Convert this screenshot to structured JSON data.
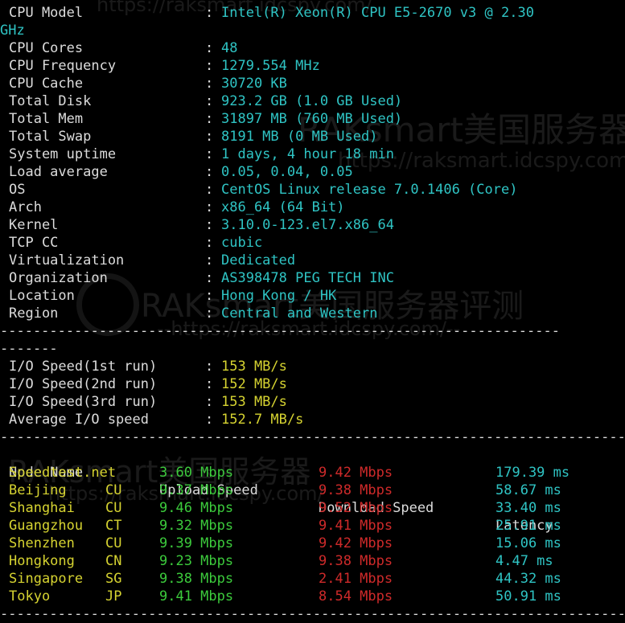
{
  "sysinfo": [
    {
      "label": "CPU Model",
      "value": "Intel(R) Xeon(R) CPU E5-2670 v3 @ 2.30"
    },
    {
      "label": "CPU Cores",
      "value": "48"
    },
    {
      "label": "CPU Frequency",
      "value": "1279.554 MHz"
    },
    {
      "label": "CPU Cache",
      "value": "30720 KB"
    },
    {
      "label": "Total Disk",
      "value": "923.2 GB (1.0 GB Used)"
    },
    {
      "label": "Total Mem",
      "value": "31897 MB (760 MB Used)"
    },
    {
      "label": "Total Swap",
      "value": "8191 MB (0 MB Used)"
    },
    {
      "label": "System uptime",
      "value": "1 days, 4 hour 18 min"
    },
    {
      "label": "Load average",
      "value": "0.05, 0.04, 0.05"
    },
    {
      "label": "OS",
      "value": "CentOS Linux release 7.0.1406 (Core)"
    },
    {
      "label": "Arch",
      "value": "x86_64 (64 Bit)"
    },
    {
      "label": "Kernel",
      "value": "3.10.0-123.el7.x86_64"
    },
    {
      "label": "TCP CC",
      "value": "cubic"
    },
    {
      "label": "Virtualization",
      "value": "Dedicated"
    },
    {
      "label": "Organization",
      "value": "AS398478 PEG TECH INC"
    },
    {
      "label": "Location",
      "value": "Hong Kong / HK"
    },
    {
      "label": "Region",
      "value": "Central and Western"
    }
  ],
  "cpu_wrap": "GHz",
  "separator": ":",
  "dash_short": "-------",
  "io": [
    {
      "label": "I/O Speed(1st run)",
      "value": "153 MB/s"
    },
    {
      "label": "I/O Speed(2nd run)",
      "value": "152 MB/s"
    },
    {
      "label": "I/O Speed(3rd run)",
      "value": "153 MB/s"
    },
    {
      "label": "Average I/O speed",
      "value": "152.7 MB/s"
    }
  ],
  "speed_headers": {
    "node": "Node Name",
    "upload": "Upload Speed",
    "download": "Download Speed",
    "latency": "Latency"
  },
  "speed_rows": [
    {
      "node": "Speedtest.net",
      "isp": "",
      "upload": "3.60 Mbps",
      "download": "9.42 Mbps",
      "latency": "179.39 ms"
    },
    {
      "node": "Beijing",
      "isp": "CU",
      "upload": "9.37 Mbps",
      "download": "9.38 Mbps",
      "latency": "58.67 ms"
    },
    {
      "node": "Shanghai",
      "isp": "CU",
      "upload": "9.46 Mbps",
      "download": "9.52 Mbps",
      "latency": "33.40 ms"
    },
    {
      "node": "Guangzhou",
      "isp": "CT",
      "upload": "9.32 Mbps",
      "download": "9.41 Mbps",
      "latency": "25.91 ms"
    },
    {
      "node": "Shenzhen",
      "isp": "CU",
      "upload": "9.39 Mbps",
      "download": "9.42 Mbps",
      "latency": "15.06 ms"
    },
    {
      "node": "Hongkong",
      "isp": "CN",
      "upload": "9.23 Mbps",
      "download": "9.38 Mbps",
      "latency": "4.47 ms"
    },
    {
      "node": "Singapore",
      "isp": "SG",
      "upload": "9.38 Mbps",
      "download": "2.41 Mbps",
      "latency": "44.32 ms"
    },
    {
      "node": "Tokyo",
      "isp": "JP",
      "upload": "9.41 Mbps",
      "download": "8.54 Mbps",
      "latency": "50.91 ms"
    }
  ],
  "watermark": {
    "brand1": "RAKsmart美国服务器",
    "url1": "https://raksmart.idcspy.com/",
    "brand2": "RAKsmart美国服务器评测",
    "url2": "--https://raksmart.idcspy.com/--",
    "brand3": "RAKsmart美国服务器",
    "url3": "https://raksmart.idcspy.com/",
    "url_top": "https://raksmart.idcspy.com/"
  },
  "colors": {
    "background": "#000000",
    "label": "#dcdcdc",
    "sys_value": "#2fc4c4",
    "io_value": "#d6d331",
    "node_name": "#d6d331",
    "upload": "#3ccb3c",
    "download": "#cf2a2a",
    "latency": "#2fc4c4"
  }
}
